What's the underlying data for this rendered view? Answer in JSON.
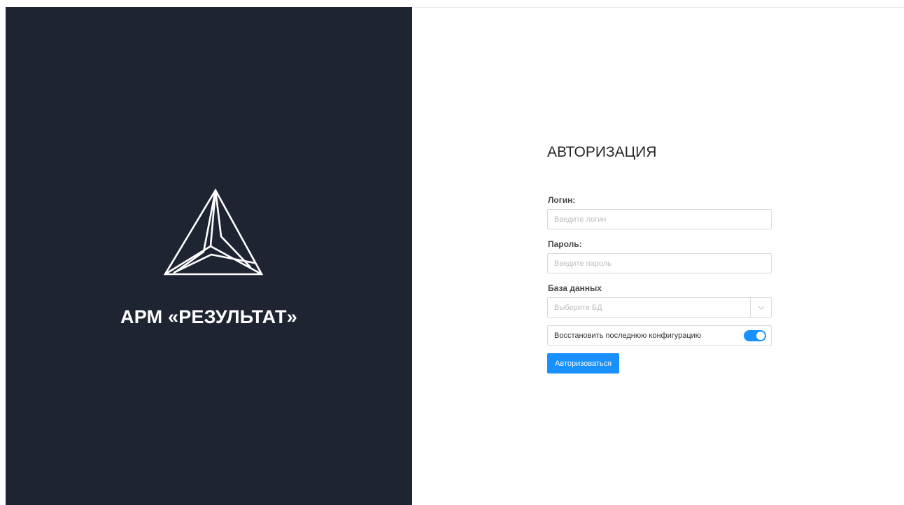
{
  "brand": {
    "app_name": "АРМ «РЕЗУЛЬТАТ»",
    "logo_icon": "triangle-logo-icon",
    "panel_color": "#1f2433"
  },
  "auth": {
    "title": "АВТОРИЗАЦИЯ",
    "login_label": "Логин:",
    "login_placeholder": "Введите логин",
    "login_value": "",
    "password_label": "Пароль:",
    "password_placeholder": "Введите пароль",
    "password_value": "",
    "database_label": "База данных",
    "database_placeholder": "Выберите БД",
    "database_icon": "chevron-down-icon",
    "restore_label": "Восстановить последнюю конфигурацию",
    "restore_enabled": true,
    "submit_label": "Авторизоваться"
  },
  "colors": {
    "accent": "#1890ff",
    "border": "#d9d9d9",
    "placeholder": "#bfbfbf"
  }
}
